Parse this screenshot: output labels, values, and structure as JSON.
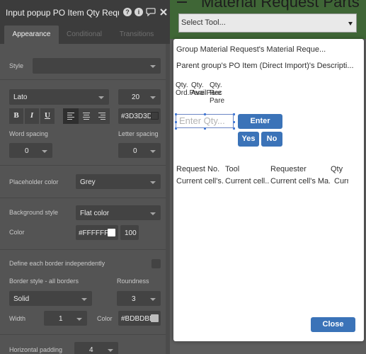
{
  "background": {
    "page_title": "Material Request Parts",
    "select_tool": "Select Tool..."
  },
  "popup": {
    "line1": "Group Material Request's Material Reque...",
    "line2": "Parent group's PO Item (Direct Import)'s Descripti...",
    "qty_headers": [
      "Qty. Ord.Pare",
      "Qty. AvailPare",
      "Qty. Rec Pare"
    ],
    "qty_input_placeholder": "Enter Qty...",
    "enter_button": "Enter",
    "yes_button": "Yes",
    "no_button": "No",
    "table_headers": [
      "Request No.",
      "Tool",
      "Requester",
      "Qty"
    ],
    "table_cells": [
      "Current cell's...",
      "Current cell...",
      "Current cell's Ma...",
      "Curr"
    ],
    "close_button": "Close"
  },
  "editor": {
    "title": "Input popup PO Item Qty Request",
    "tabs": {
      "appearance": "Appearance",
      "conditional": "Conditional",
      "transitions": "Transitions"
    },
    "style_label": "Style",
    "style_value": "",
    "font_value": "Lato",
    "font_size": "20",
    "bold": "B",
    "italic": "I",
    "underline": "U",
    "text_color": "#3D3D3D",
    "word_spacing_label": "Word spacing",
    "word_spacing_value": "0",
    "letter_spacing_label": "Letter spacing",
    "letter_spacing_value": "0",
    "placeholder_color_label": "Placeholder color",
    "placeholder_color_value": "Grey",
    "bg_style_label": "Background style",
    "bg_style_value": "Flat color",
    "color_label": "Color",
    "bg_color": "#FFFFFF",
    "bg_opacity": "100",
    "define_border_label": "Define each border independently",
    "border_style_label": "Border style - all borders",
    "border_style_value": "Solid",
    "roundness_label": "Roundness",
    "roundness_value": "3",
    "width_label": "Width",
    "width_value": "1",
    "border_color_label": "Color",
    "border_color": "#BDBDBD",
    "h_padding_label": "Horizontal padding",
    "h_padding_value": "4"
  },
  "colors": {
    "accent": "#3b73b8",
    "text_color_swatch": "#3d3d3d",
    "bg_color_swatch": "#ffffff",
    "border_color_swatch": "#bdbdbd"
  }
}
